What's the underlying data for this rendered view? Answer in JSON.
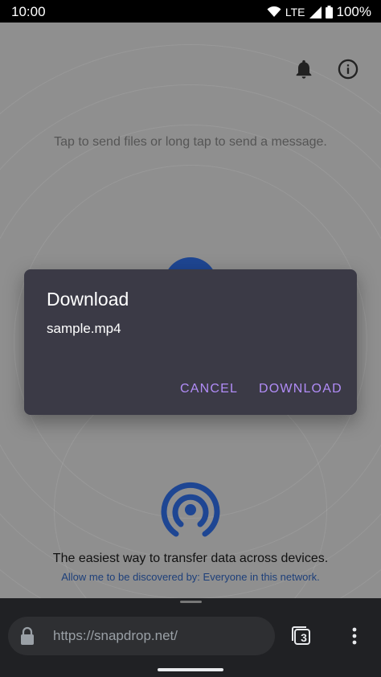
{
  "status_bar": {
    "time": "10:00",
    "network": "LTE",
    "battery": "100%",
    "icons": [
      "wifi-icon",
      "signal-icon",
      "battery-icon"
    ]
  },
  "app": {
    "header_icons": [
      "bell-icon",
      "info-icon"
    ],
    "instructions": "Tap to send files or long tap to send a message.",
    "tagline": "The easiest way to transfer data across devices.",
    "discover_text": "Allow me to be discovered by: Everyone in this network.",
    "logo_icon": "snapdrop-logo-icon"
  },
  "dialog": {
    "title": "Download",
    "filename": "sample.mp4",
    "cancel_label": "CANCEL",
    "download_label": "DOWNLOAD"
  },
  "browser": {
    "url": "https://snapdrop.net/",
    "tab_count": "3",
    "icons": [
      "lock-icon",
      "tabs-icon",
      "more-vert-icon"
    ]
  },
  "colors": {
    "scrim_bg": "#8f8f8f",
    "dialog_bg": "#3b3a46",
    "accent": "#b18cf7",
    "brand_blue": "#1e4693",
    "browser_bar": "#202124"
  }
}
